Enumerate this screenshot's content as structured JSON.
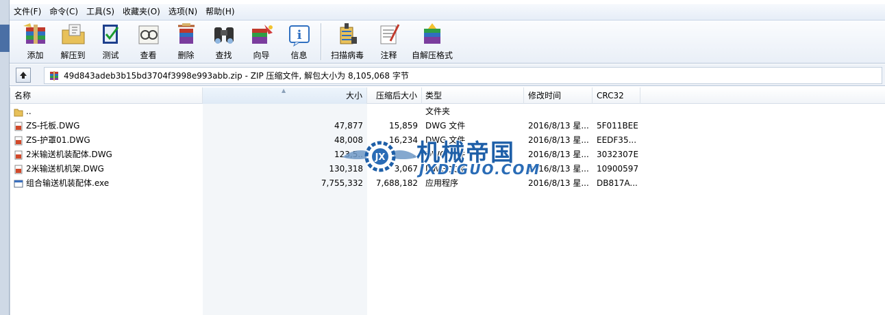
{
  "menu": [
    "文件(F)",
    "命令(C)",
    "工具(S)",
    "收藏夹(O)",
    "选项(N)",
    "帮助(H)"
  ],
  "toolbar": [
    {
      "label": "添加",
      "icon": "add-archive-icon"
    },
    {
      "label": "解压到",
      "icon": "extract-to-icon"
    },
    {
      "label": "测试",
      "icon": "test-icon"
    },
    {
      "label": "查看",
      "icon": "view-icon"
    },
    {
      "label": "删除",
      "icon": "delete-icon"
    },
    {
      "label": "查找",
      "icon": "find-icon"
    },
    {
      "label": "向导",
      "icon": "wizard-icon"
    },
    {
      "label": "信息",
      "icon": "info-icon"
    },
    {
      "label": "扫描病毒",
      "icon": "virus-scan-icon"
    },
    {
      "label": "注释",
      "icon": "comment-icon"
    },
    {
      "label": "自解压格式",
      "icon": "sfx-icon"
    }
  ],
  "address": {
    "text": "49d843adeb3b15bd3704f3998e993abb.zip - ZIP 压缩文件, 解包大小为 8,105,068 字节"
  },
  "columns": {
    "name": "名称",
    "size": "大小",
    "packed": "压缩后大小",
    "type": "类型",
    "modified": "修改时间",
    "crc": "CRC32"
  },
  "files": [
    {
      "name": "..",
      "size": "",
      "packed": "",
      "type": "文件夹",
      "modified": "",
      "crc": "",
      "icon": "folder-icon"
    },
    {
      "name": "ZS-托板.DWG",
      "size": "47,877",
      "packed": "15,859",
      "type": "DWG 文件",
      "modified": "2016/8/13 星...",
      "crc": "5F011BEE",
      "icon": "dwg-file-icon"
    },
    {
      "name": "ZS-护罩01.DWG",
      "size": "48,008",
      "packed": "16,234",
      "type": "DWG 文件",
      "modified": "2016/8/13 星...",
      "crc": "EEDF35...",
      "icon": "dwg-file-icon"
    },
    {
      "name": "2米输送机装配体.DWG",
      "size": "123,5..",
      "packed": "..",
      "type": "DWG 文件",
      "modified": "2016/8/13 星...",
      "crc": "3032307E",
      "icon": "dwg-file-icon"
    },
    {
      "name": "2米输送机机架.DWG",
      "size": "130,318",
      "packed": "3,067",
      "type": "DWG 文件",
      "modified": "2016/8/13 星...",
      "crc": "10900597",
      "icon": "dwg-file-icon"
    },
    {
      "name": "组合输送机装配体.exe",
      "size": "7,755,332",
      "packed": "7,688,182",
      "type": "应用程序",
      "modified": "2016/8/13 星...",
      "crc": "DB817A...",
      "icon": "exe-file-icon"
    }
  ],
  "watermark": {
    "cn": "机械帝国",
    "en": "JXDIGUO.COM"
  },
  "colors": {
    "accent": "#1e5fa8",
    "toolbar_bg": "#e9eff7"
  }
}
